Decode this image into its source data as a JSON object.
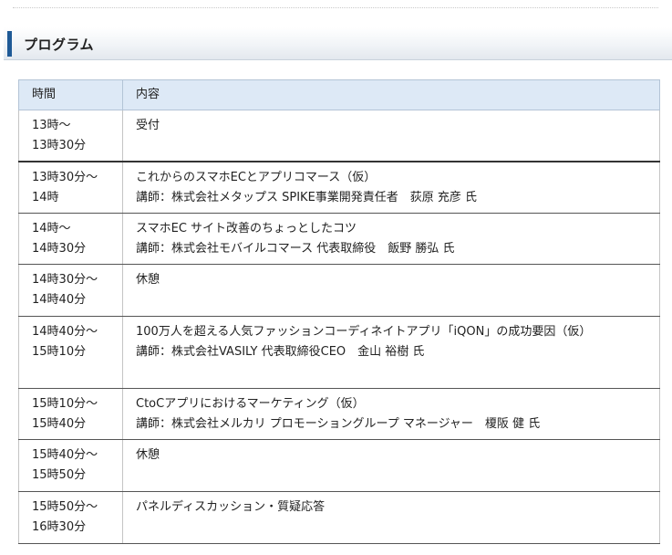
{
  "section": {
    "title": "プログラム"
  },
  "table": {
    "headers": {
      "time": "時間",
      "content": "内容"
    },
    "rows": [
      {
        "time_start": "13時〜",
        "time_end": "13時30分",
        "title": "受付",
        "speaker": ""
      },
      {
        "time_start": "13時30分〜",
        "time_end": "14時",
        "title": "これからのスマホECとアプリコマース（仮）",
        "speaker": "講師：株式会社メタップス SPIKE事業開発責任者　荻原 充彦 氏"
      },
      {
        "time_start": "14時〜",
        "time_end": "14時30分",
        "title": "スマホEC サイト改善のちょっとしたコツ",
        "speaker": "講師：株式会社モバイルコマース 代表取締役　飯野 勝弘 氏"
      },
      {
        "time_start": "14時30分〜",
        "time_end": "14時40分",
        "title": "休憩",
        "speaker": ""
      },
      {
        "time_start": "14時40分〜",
        "time_end": "15時10分",
        "title": "100万人を超える人気ファッションコーディネイトアプリ「iQON」の成功要因（仮）",
        "speaker": "講師：株式会社VASILY 代表取締役CEO　金山 裕樹 氏"
      },
      {
        "time_start": "15時10分〜",
        "time_end": "15時40分",
        "title": "CtoCアプリにおけるマーケティング（仮）",
        "speaker": "講師：株式会社メルカリ プロモーショングループ マネージャー　榎阪 健 氏"
      },
      {
        "time_start": "15時40分〜",
        "time_end": "15時50分",
        "title": "休憩",
        "speaker": ""
      },
      {
        "time_start": "15時50分〜",
        "time_end": "16時30分",
        "title": "パネルディスカッション・質疑応答",
        "speaker": ""
      }
    ]
  }
}
